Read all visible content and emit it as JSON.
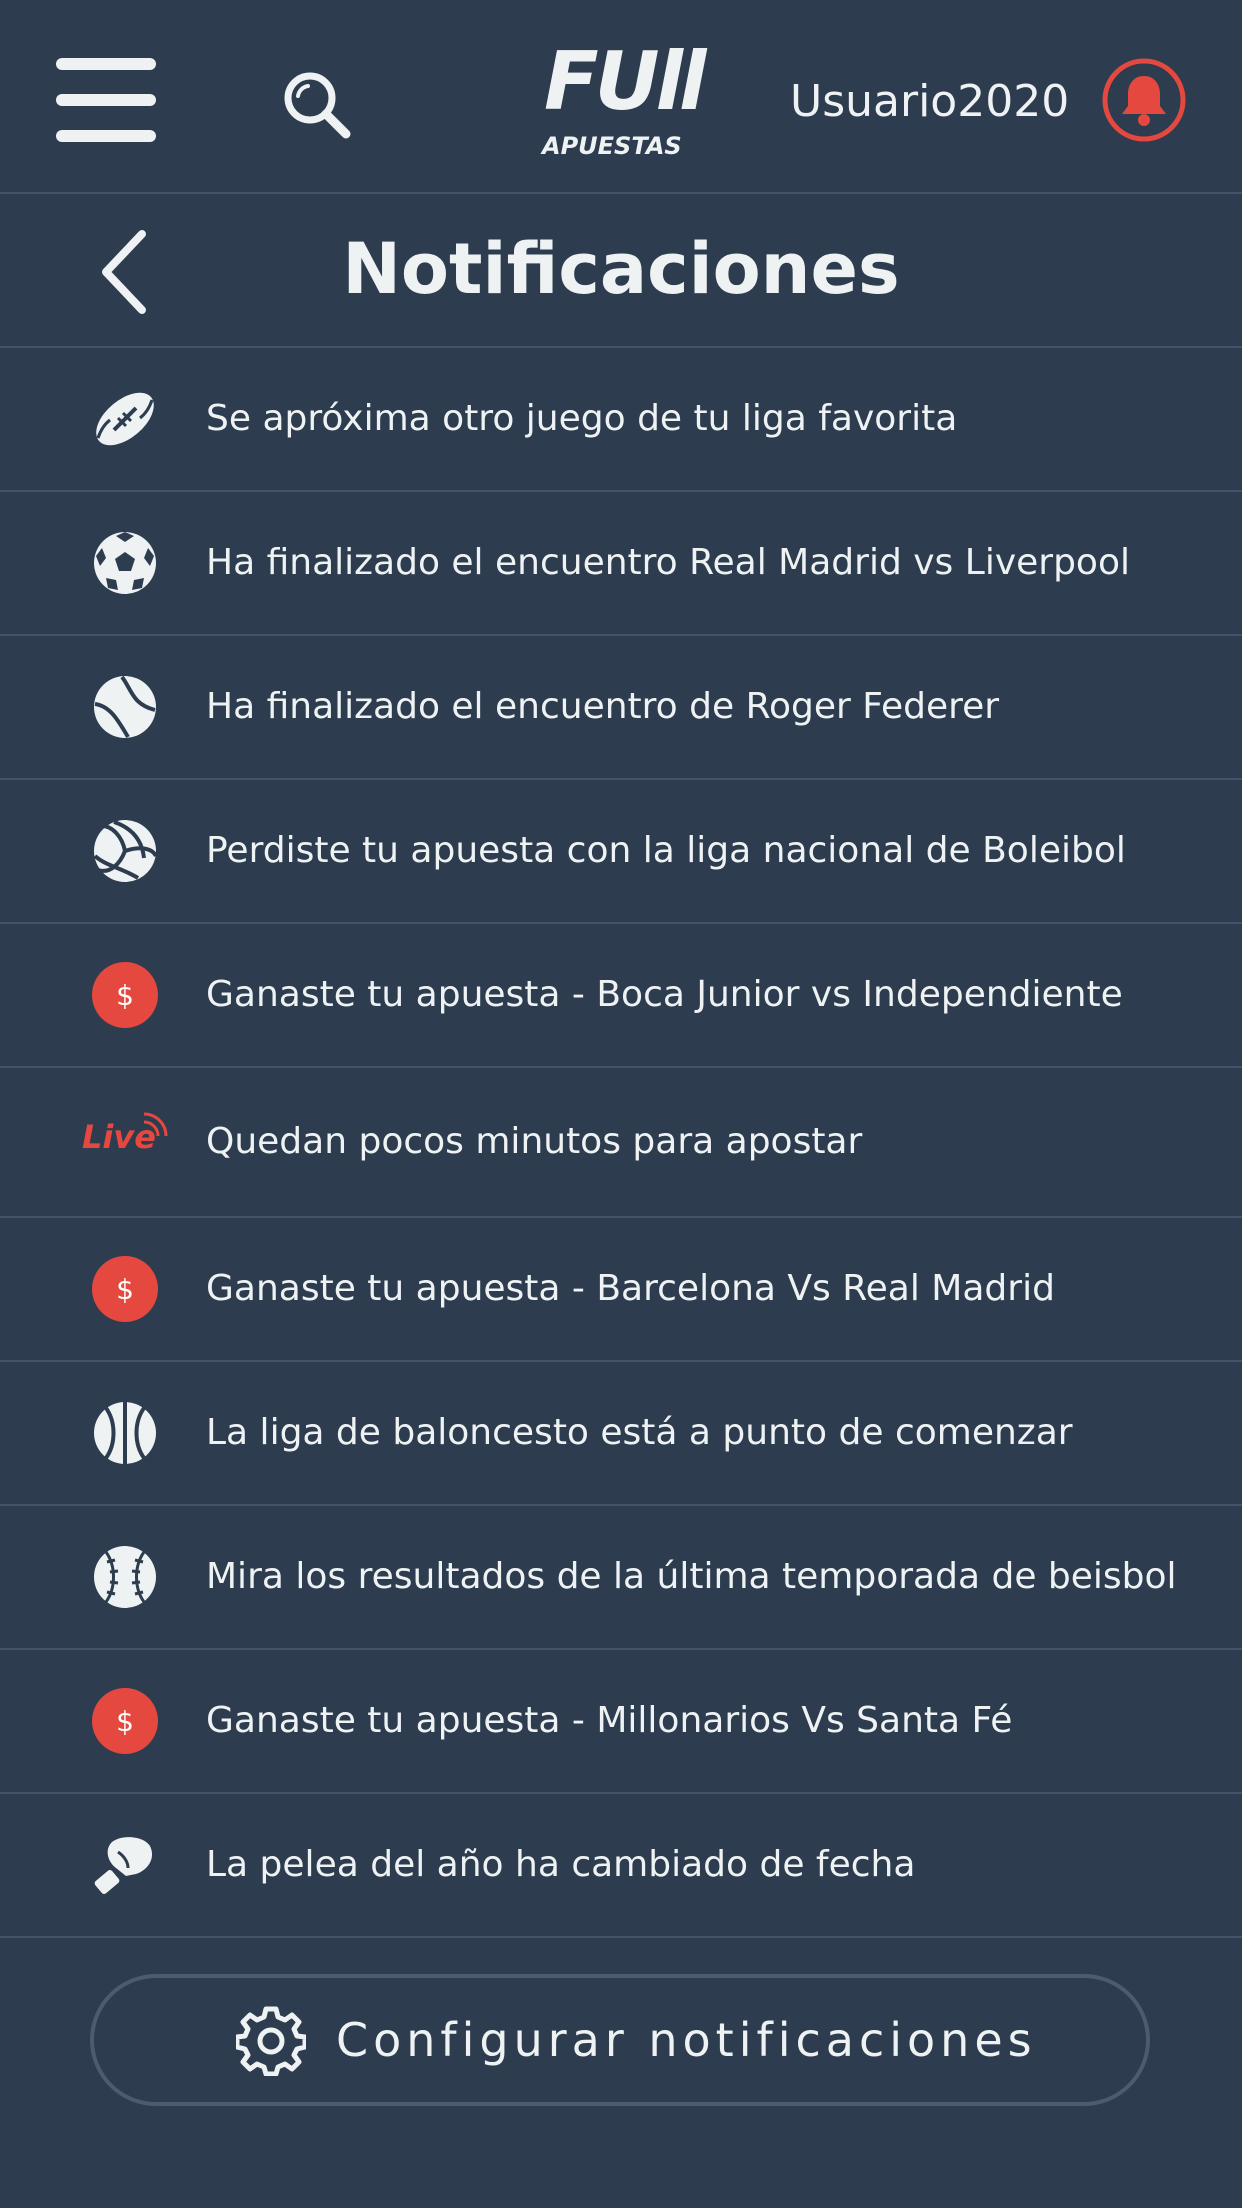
{
  "header": {
    "logo_main": "FUll",
    "logo_sub": "APUESTAS",
    "username": "Usuario2020"
  },
  "page": {
    "title": "Notificaciones"
  },
  "notifications": [
    {
      "icon": "football-icon",
      "text": "Se apróxima otro juego de tu liga favorita"
    },
    {
      "icon": "soccer-ball-icon",
      "text": "Ha finalizado el encuentro Real Madrid vs Liverpool"
    },
    {
      "icon": "tennis-ball-icon",
      "text": "Ha finalizado el encuentro de Roger Federer"
    },
    {
      "icon": "volleyball-icon",
      "text": "Perdiste tu apuesta con la liga nacional de Boleibol"
    },
    {
      "icon": "dollar-icon",
      "text": "Ganaste tu apuesta - Boca Junior vs Independiente"
    },
    {
      "icon": "live-icon",
      "icon_text": "Live",
      "text": "Quedan pocos minutos para apostar"
    },
    {
      "icon": "dollar-icon",
      "text": "Ganaste tu apuesta -  Barcelona Vs Real Madrid"
    },
    {
      "icon": "basketball-icon",
      "text": "La liga de baloncesto está a punto de comenzar"
    },
    {
      "icon": "baseball-icon",
      "text": "Mira los resultados de la última temporada de beisbol"
    },
    {
      "icon": "dollar-icon",
      "text": "Ganaste tu apuesta -  Millonarios Vs Santa Fé"
    },
    {
      "icon": "boxing-glove-icon",
      "text": "La pelea del año ha cambiado de fecha"
    }
  ],
  "footer": {
    "config_label": "Configurar notificaciones"
  },
  "colors": {
    "background": "#2d3c4f",
    "accent": "#e5483e",
    "text": "#eef2f3",
    "divider": "#44546a"
  }
}
